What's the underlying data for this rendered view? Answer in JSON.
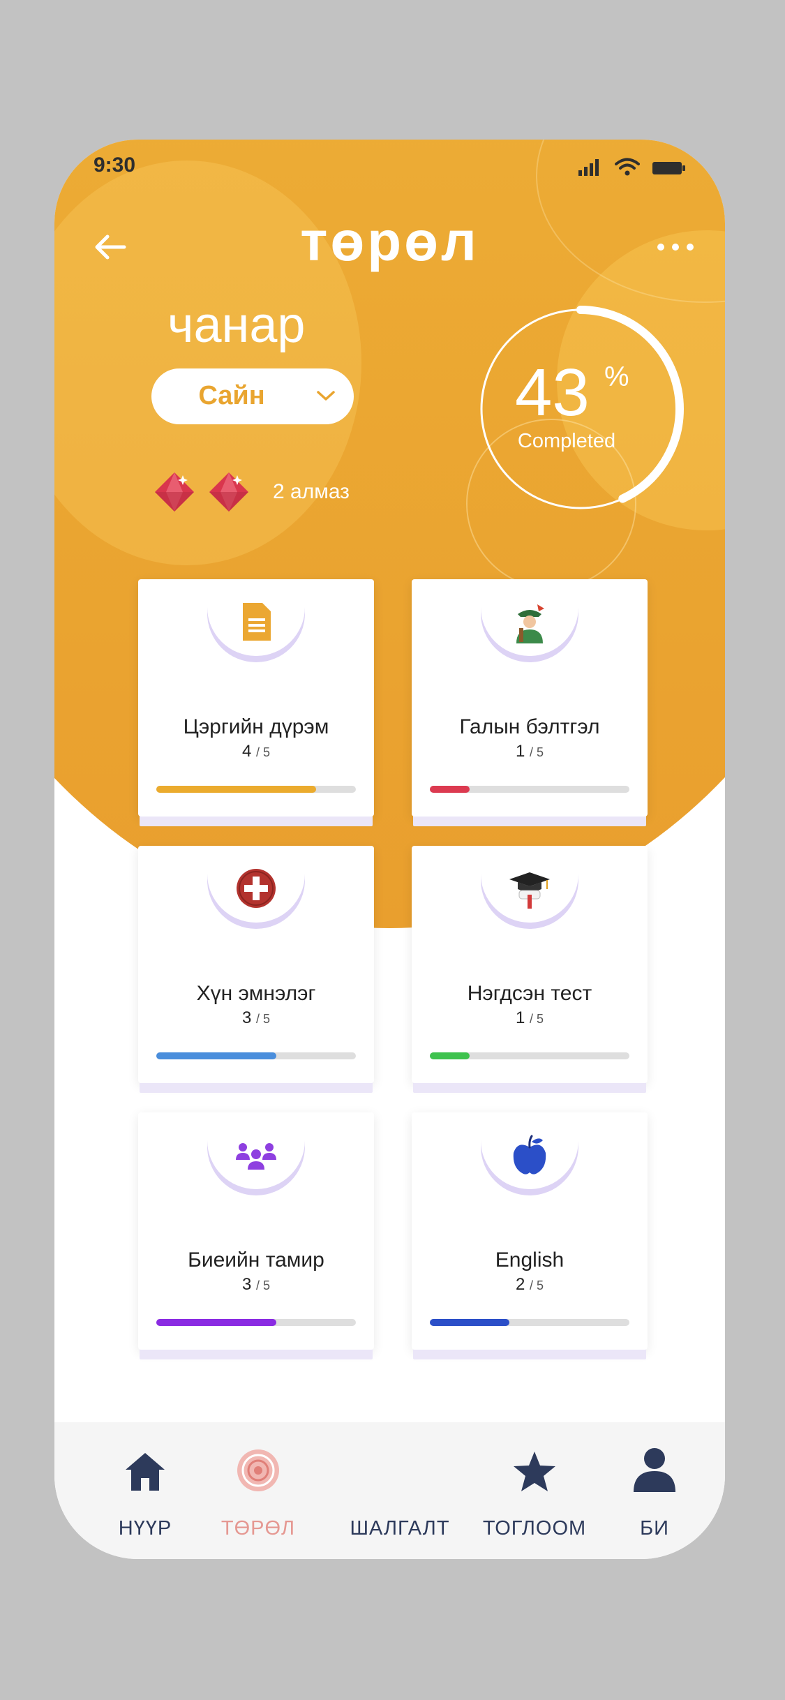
{
  "status_bar": {
    "time": "9:30"
  },
  "header": {
    "title": "төрөл"
  },
  "quality": {
    "label": "чанар",
    "selected": "Сайн"
  },
  "gems": {
    "count_label": "2 алмаз"
  },
  "progress": {
    "percent": 43,
    "percent_text": "43",
    "percent_symbol": "%",
    "sub_label": "Completed"
  },
  "categories": [
    {
      "title": "Цэргийн дүрэм",
      "done": "4",
      "total": "/ 5",
      "fraction": 0.8,
      "bar_color": "#ebab2e",
      "icon": "document-icon"
    },
    {
      "title": "Галын бэлтгэл",
      "done": "1",
      "total": "/ 5",
      "fraction": 0.2,
      "bar_color": "#dc3a50",
      "icon": "soldier-icon"
    },
    {
      "title": "Хүн эмнэлэг",
      "done": "3",
      "total": "/ 5",
      "fraction": 0.6,
      "bar_color": "#4a8edc",
      "icon": "medical-cross-icon"
    },
    {
      "title": "Нэгдсэн тест",
      "done": "1",
      "total": "/ 5",
      "fraction": 0.2,
      "bar_color": "#3ec24e",
      "icon": "graduation-cap-icon"
    },
    {
      "title": "Биеийн тамир",
      "done": "3",
      "total": "/ 5",
      "fraction": 0.6,
      "bar_color": "#8a2be2",
      "icon": "people-group-icon"
    },
    {
      "title": "English",
      "done": "2",
      "total": "/ 5",
      "fraction": 0.4,
      "bar_color": "#2b4fc8",
      "icon": "apple-icon"
    }
  ],
  "tabs": [
    {
      "label": "НҮҮР",
      "icon": "home-icon"
    },
    {
      "label": "ТӨРӨЛ",
      "icon": "target-icon",
      "active": true
    },
    {
      "label": "ШАЛГАЛТ",
      "icon": ""
    },
    {
      "label": "ТОГЛООМ",
      "icon": "star-icon"
    },
    {
      "label": "БИ",
      "icon": "user-icon"
    }
  ],
  "colors": {
    "accent": "#eba732",
    "active_tab": "#e59892",
    "tab_text": "#2d3a5b"
  }
}
